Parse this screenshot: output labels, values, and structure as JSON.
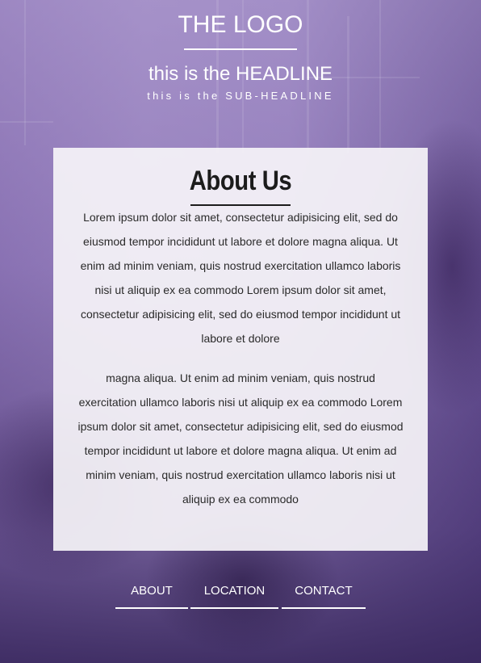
{
  "header": {
    "logo": "THE LOGO",
    "headline": "this is the HEADLINE",
    "subheadline": "this is the SUB-HEADLINE"
  },
  "about": {
    "title": "About Us",
    "paragraphs": [
      "Lorem ipsum dolor sit amet, consectetur adipisicing elit, sed do eiusmod tempor incididunt ut labore et dolore magna aliqua. Ut enim ad minim veniam, quis nostrud exercitation ullamco laboris nisi ut aliquip ex ea commodo Lorem ipsum dolor sit amet, consectetur adipisicing elit, sed do eiusmod tempor incididunt ut labore et dolore",
      "magna aliqua. Ut enim ad minim veniam, quis nostrud exercitation ullamco laboris nisi ut aliquip ex ea commodo Lorem ipsum dolor sit amet, consectetur adipisicing elit, sed do eiusmod tempor incididunt ut labore et dolore magna aliqua. Ut enim ad minim veniam, quis nostrud exercitation ullamco laboris nisi ut aliquip ex ea commodo"
    ]
  },
  "nav": {
    "items": [
      {
        "label": "ABOUT"
      },
      {
        "label": "LOCATION"
      },
      {
        "label": "CONTACT"
      }
    ]
  },
  "colors": {
    "overlay_purple": "#8d76b5",
    "card_background": "#f5f3f8",
    "text_dark": "#1c1c1c",
    "header_text": "#ffffff"
  }
}
